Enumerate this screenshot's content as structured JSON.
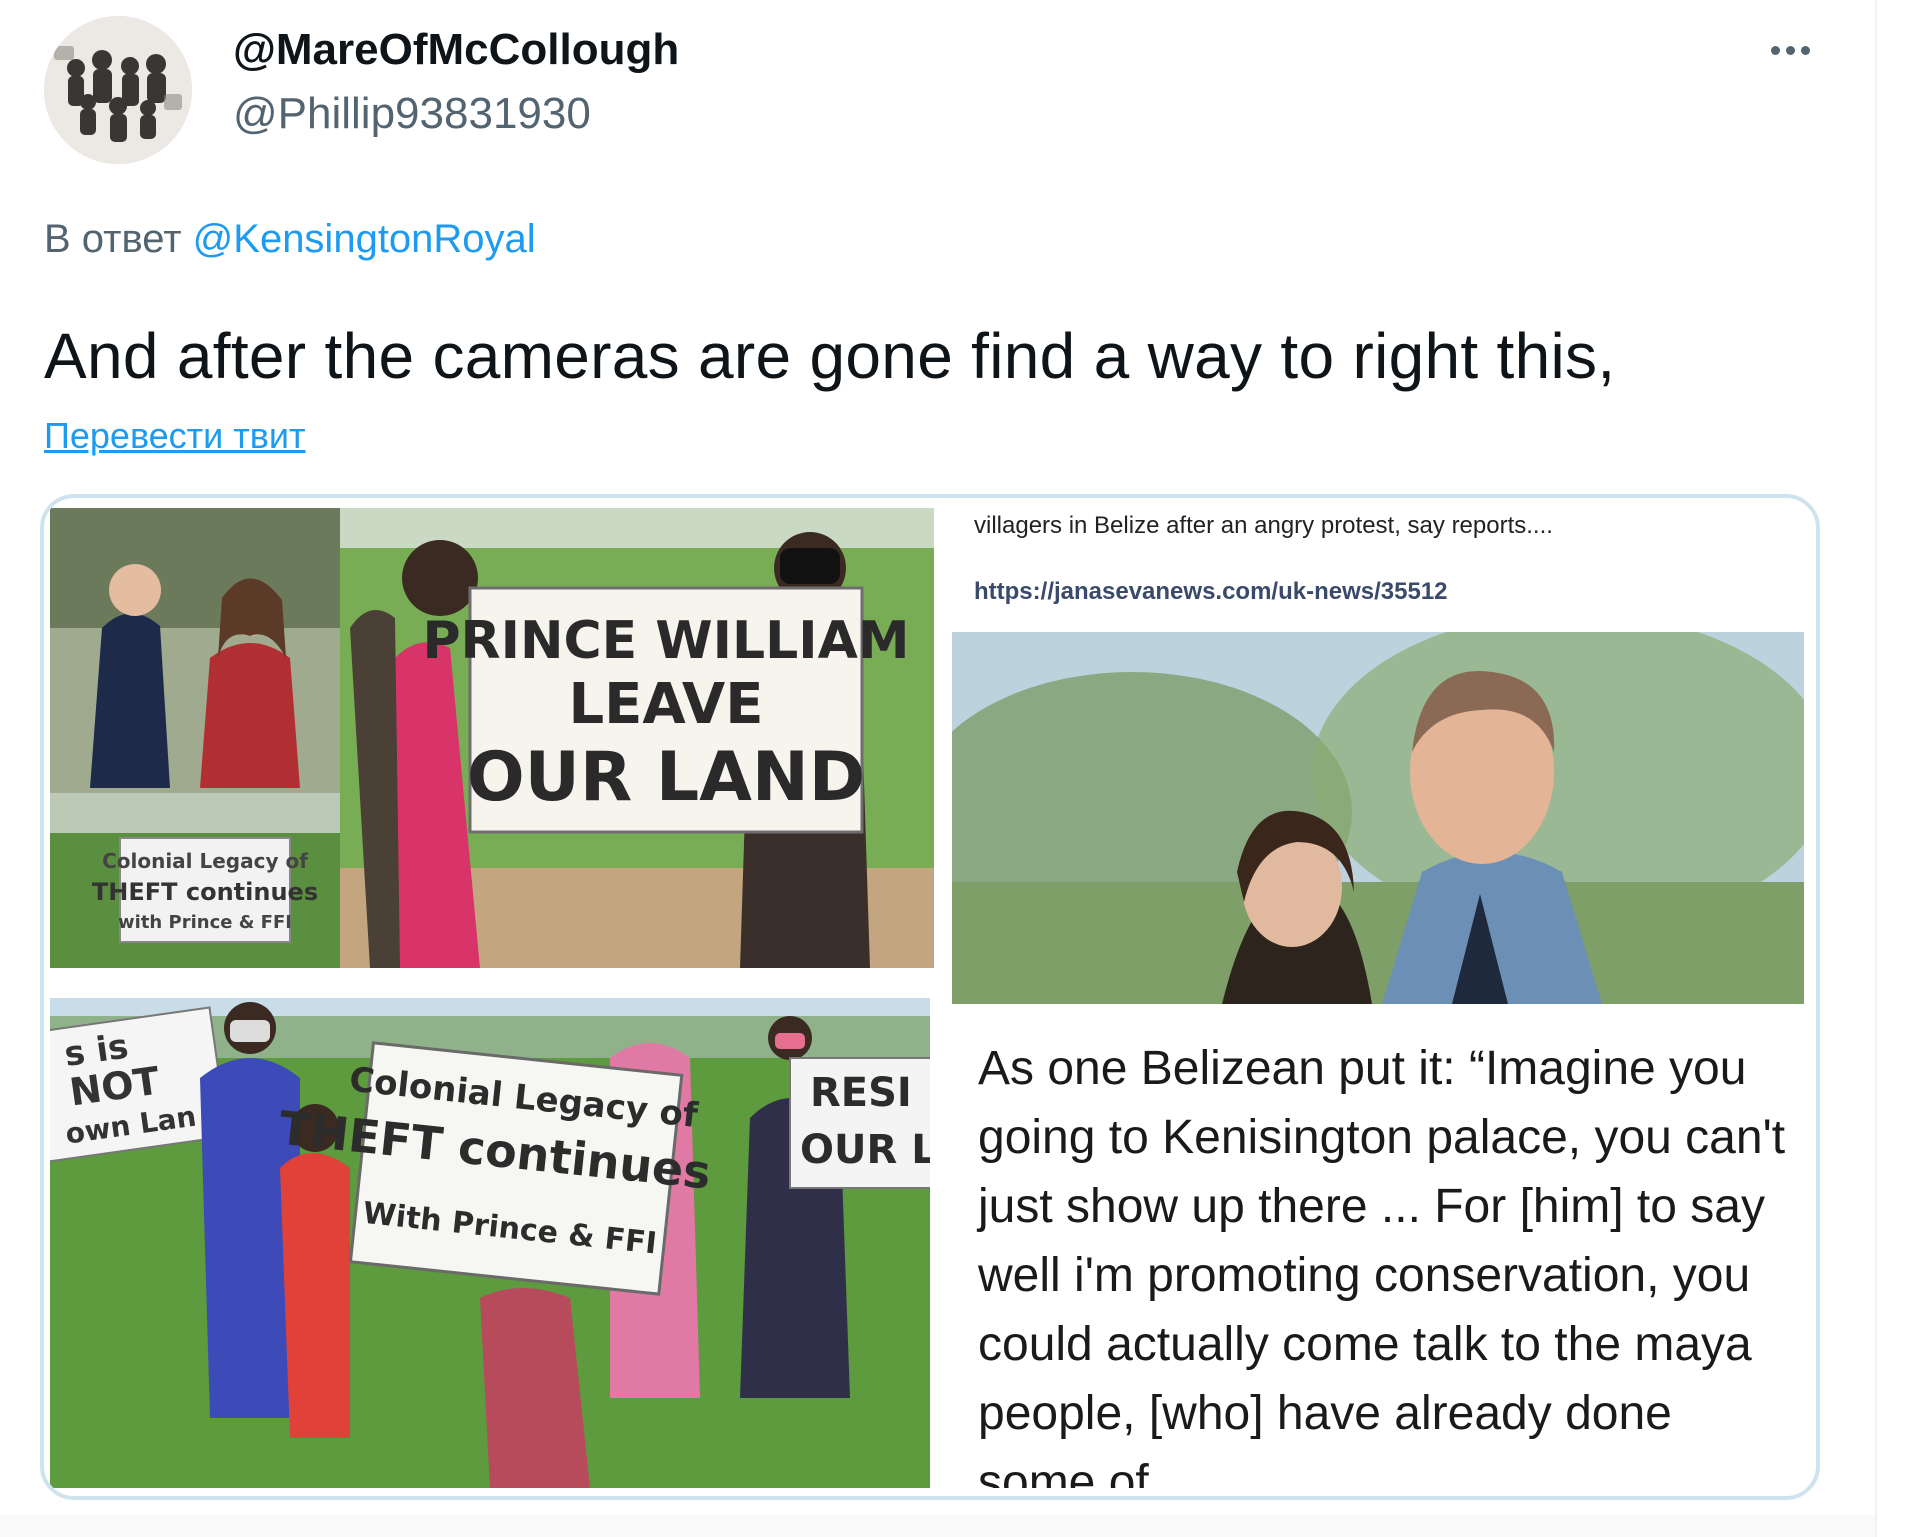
{
  "author": {
    "display_name": "@MareOfMcCollough",
    "handle": "@Phillip93831930",
    "avatar_icon": "avatar-photo"
  },
  "more_icon": "more-horizontal-icon",
  "reply": {
    "prefix": "В ответ",
    "mention": "@KensingtonRoyal"
  },
  "tweet": {
    "text": "And after the cameras are gone find a way to right this,",
    "translate_label": "Перевести твит"
  },
  "media": {
    "protest_sign_1": "PRINCE WILLIAM LEAVE OUR LAND",
    "inset_sign": "Colonial Legacy of THEFT continues with Prince & FFI",
    "article_snippet": "villagers in Belize after an angry protest, say reports....",
    "article_url": "https://janasevanews.com/uk-news/35512",
    "sign_left_partial": "s is NOT own Lan",
    "sign_main": "Colonial Legacy of THEFT continues With Prince & FFI",
    "sign_right_partial": "RESI OUR L",
    "quote": "As one Belizean put it: “Imagine you going to Kenisington palace, you can't just show up there ... For [him] to say well i'm promoting conservation, you could actually come talk to the maya people, [who] have already done some of"
  },
  "colors": {
    "link": "#1d9bf0",
    "secondary_text": "#536471",
    "card_border": "#cfe3ef"
  }
}
